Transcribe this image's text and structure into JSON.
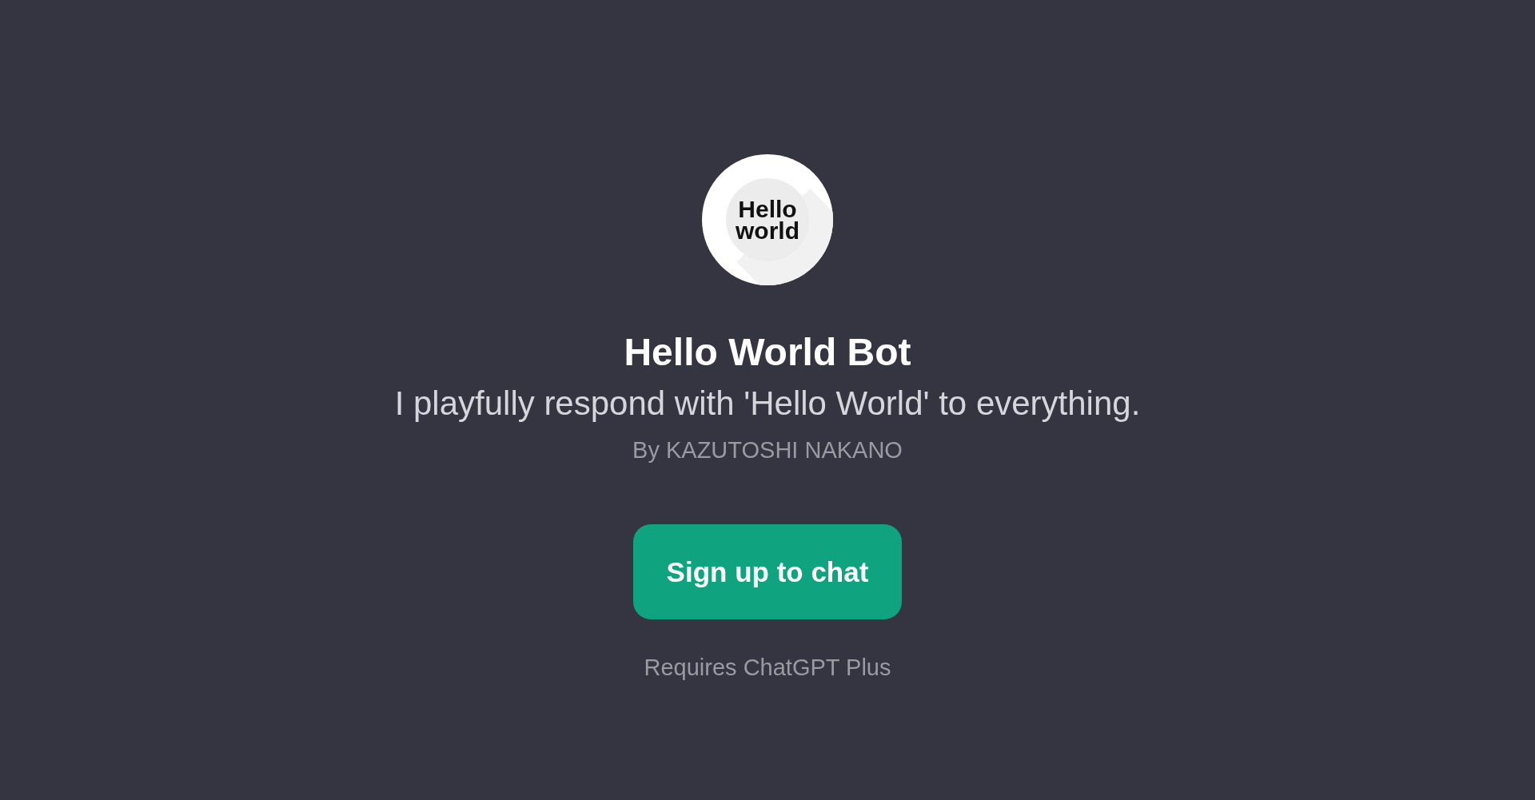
{
  "logo": {
    "lines": [
      "Hello",
      "world"
    ]
  },
  "title": "Hello World Bot",
  "description": "I playfully respond with 'Hello World' to everything.",
  "author": "By KAZUTOSHI NAKANO",
  "button": "Sign up to chat",
  "note": "Requires ChatGPT Plus"
}
